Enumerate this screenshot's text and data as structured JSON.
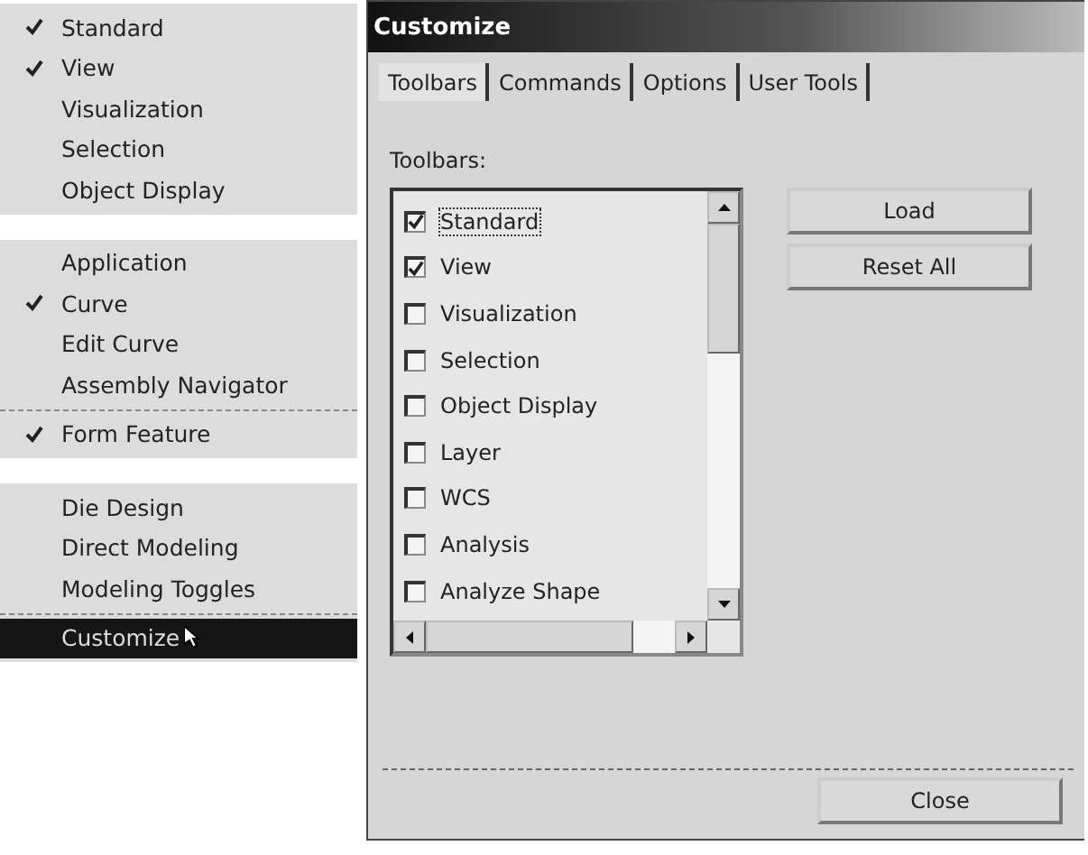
{
  "menu": {
    "groups": [
      {
        "kind": "gap",
        "items": [
          {
            "label": "Standard",
            "checked": true,
            "selected": false
          },
          {
            "label": "View",
            "checked": true,
            "selected": false
          },
          {
            "label": "Visualization",
            "checked": false,
            "selected": false
          },
          {
            "label": "Selection",
            "checked": false,
            "selected": false
          },
          {
            "label": "Object Display",
            "checked": false,
            "selected": false
          }
        ]
      },
      {
        "kind": "line",
        "items": [
          {
            "label": "Application",
            "checked": false,
            "selected": false
          },
          {
            "label": "Curve",
            "checked": true,
            "selected": false
          },
          {
            "label": "Edit Curve",
            "checked": false,
            "selected": false
          },
          {
            "label": "Assembly Navigator",
            "checked": false,
            "selected": false
          }
        ]
      },
      {
        "kind": "gap",
        "items": [
          {
            "label": "Form Feature",
            "checked": true,
            "selected": false
          }
        ]
      },
      {
        "kind": "line",
        "items": [
          {
            "label": "Die Design",
            "checked": false,
            "selected": false
          },
          {
            "label": "Direct Modeling",
            "checked": false,
            "selected": false
          },
          {
            "label": "Modeling Toggles",
            "checked": false,
            "selected": false
          }
        ]
      },
      {
        "kind": "last",
        "items": [
          {
            "label": "Customize",
            "checked": false,
            "selected": true
          }
        ]
      }
    ]
  },
  "dialog": {
    "title": "Customize",
    "tabs": [
      {
        "label": "Toolbars",
        "selected": true
      },
      {
        "label": "Commands",
        "selected": false
      },
      {
        "label": "Options",
        "selected": false
      },
      {
        "label": "User Tools",
        "selected": false
      }
    ],
    "list_label": "Toolbars:",
    "toolbars": [
      {
        "label": "Standard",
        "checked": true,
        "selected": true
      },
      {
        "label": "View",
        "checked": true,
        "selected": false
      },
      {
        "label": "Visualization",
        "checked": false,
        "selected": false
      },
      {
        "label": "Selection",
        "checked": false,
        "selected": false
      },
      {
        "label": "Object Display",
        "checked": false,
        "selected": false
      },
      {
        "label": "Layer",
        "checked": false,
        "selected": false
      },
      {
        "label": "WCS",
        "checked": false,
        "selected": false
      },
      {
        "label": "Analysis",
        "checked": false,
        "selected": false
      },
      {
        "label": "Analyze Shape",
        "checked": false,
        "selected": false
      }
    ],
    "buttons": [
      "Load",
      "Reset All"
    ],
    "close": "Close"
  }
}
